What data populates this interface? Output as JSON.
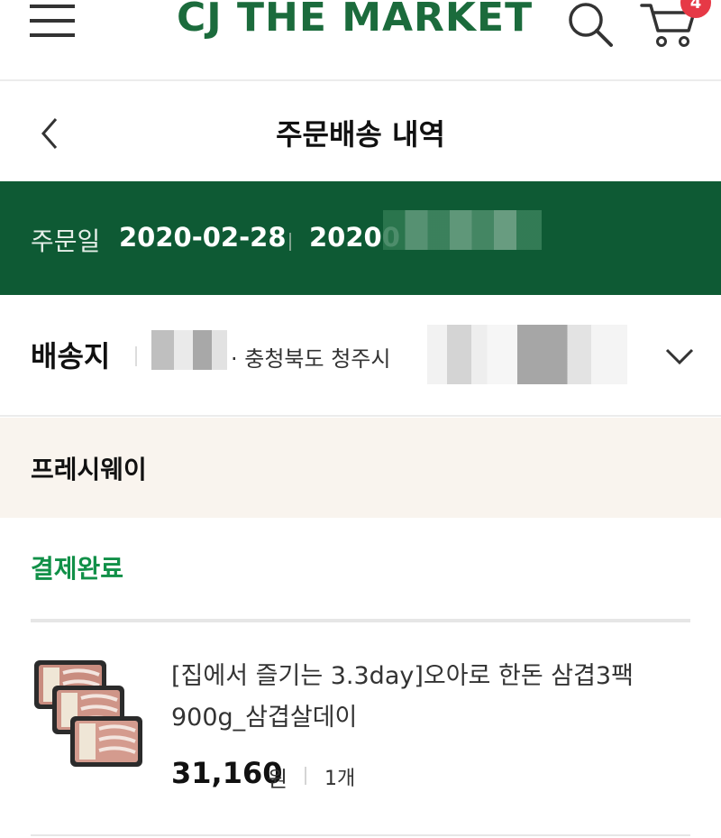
{
  "header": {
    "brand": "CJ THE MARKET",
    "cart_count": "4"
  },
  "page": {
    "title": "주문배송 내역"
  },
  "order": {
    "date_label": "주문일",
    "date": "2020-02-28",
    "number_prefix": "20200"
  },
  "shipping": {
    "label": "배송지",
    "address_visible": "· 충청북도 청주시 "
  },
  "seller": {
    "name": "프레시웨이"
  },
  "status": {
    "payment": "결제완료"
  },
  "product": {
    "name": "[집에서 즐기는 3.3day]오아로 한돈 삼겹3팩 900g_삼겹살데이",
    "price": "31,160",
    "price_unit": "원",
    "quantity": "1개"
  },
  "icons": {
    "menu": "hamburger-icon",
    "search": "search-icon",
    "cart": "cart-icon",
    "back": "chevron-left-icon",
    "expand": "chevron-down-icon"
  },
  "colors": {
    "brand_green": "#1b6b3c",
    "order_band": "#0e5a34",
    "status_green": "#119048",
    "badge_red": "#e63946",
    "seller_band": "#f9f4ee"
  }
}
